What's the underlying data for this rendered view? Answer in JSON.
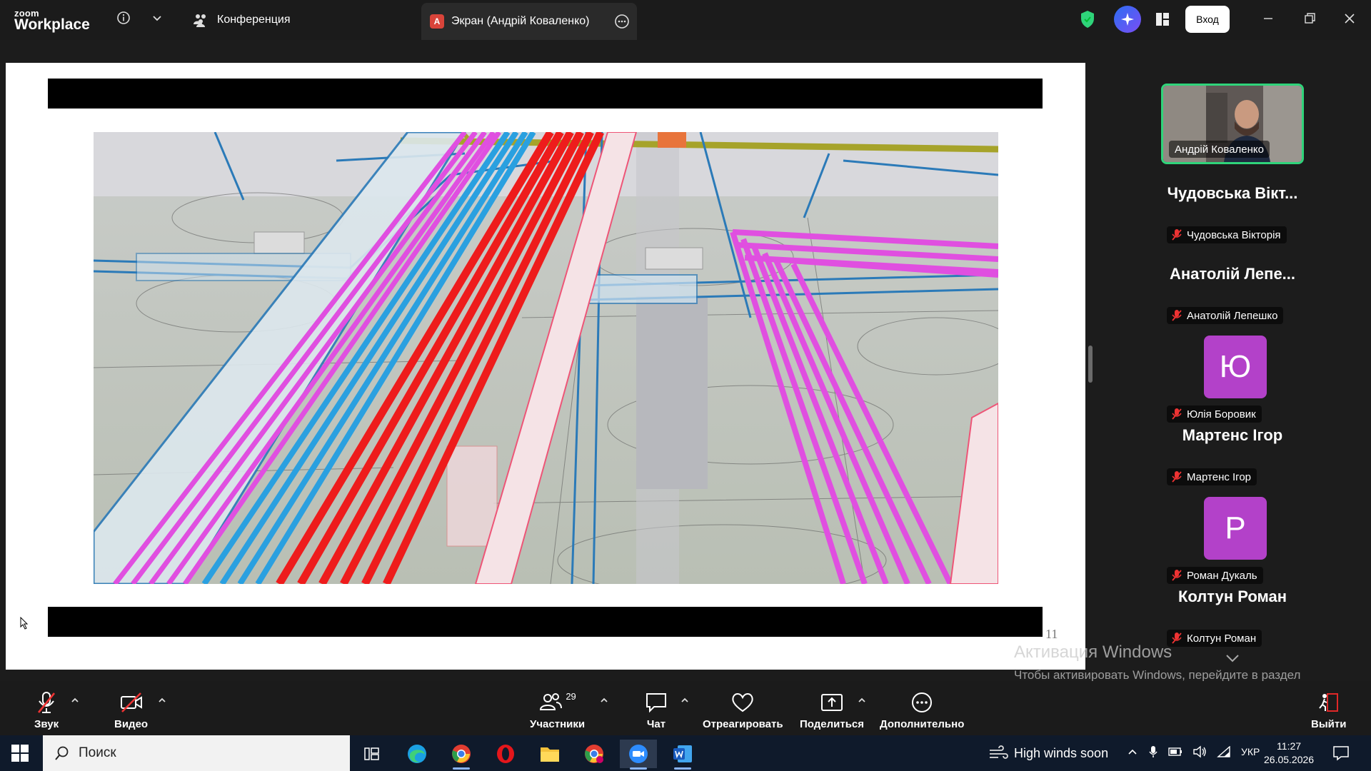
{
  "topbar": {
    "logo_line1": "zoom",
    "logo_line2": "Workplace",
    "conference_label": "Конференция",
    "screen_tab_badge": "A",
    "screen_tab_label": "Экран (Андрій Коваленко)",
    "login_label": "Вход",
    "accent_green": "#2fd47a"
  },
  "slide": {
    "page_number": "11"
  },
  "participants": [
    {
      "display": "video",
      "tag": "Андрій Коваленко",
      "muted": false
    },
    {
      "display": "name",
      "big": "Чудовська Вікт...",
      "tag": "Чудовська Вікторія",
      "muted": true
    },
    {
      "display": "name",
      "big": "Анатолій Лепе...",
      "tag": "Анатолій Лепешко",
      "muted": true
    },
    {
      "display": "avatar",
      "letter": "Ю",
      "tag": "Юлія Боровик",
      "muted": true,
      "color": "#b341c9"
    },
    {
      "display": "name",
      "big": "Мартенс Ігор",
      "tag": "Мартенс Ігор",
      "muted": true
    },
    {
      "display": "avatar",
      "letter": "Р",
      "tag": "Роман Дукаль",
      "muted": true,
      "color": "#b341c9"
    },
    {
      "display": "name",
      "big": "Колтун Роман",
      "tag": "Колтун Роман",
      "muted": true
    }
  ],
  "watermark": {
    "title": "Активация Windows",
    "body": "Чтобы активировать Windows, перейдите в раздел \"Параметры\"."
  },
  "toolbar": {
    "audio": "Звук",
    "video": "Видео",
    "participants": "Участники",
    "participants_count": "29",
    "chat": "Чат",
    "react": "Отреагировать",
    "share": "Поделиться",
    "more": "Дополнительно",
    "leave": "Выйти",
    "leave_color": "#e02828"
  },
  "taskbar": {
    "search_placeholder": "Поиск",
    "weather": "High winds soon",
    "language": "УКР",
    "time": "11:27",
    "date": "26.05.2026"
  }
}
